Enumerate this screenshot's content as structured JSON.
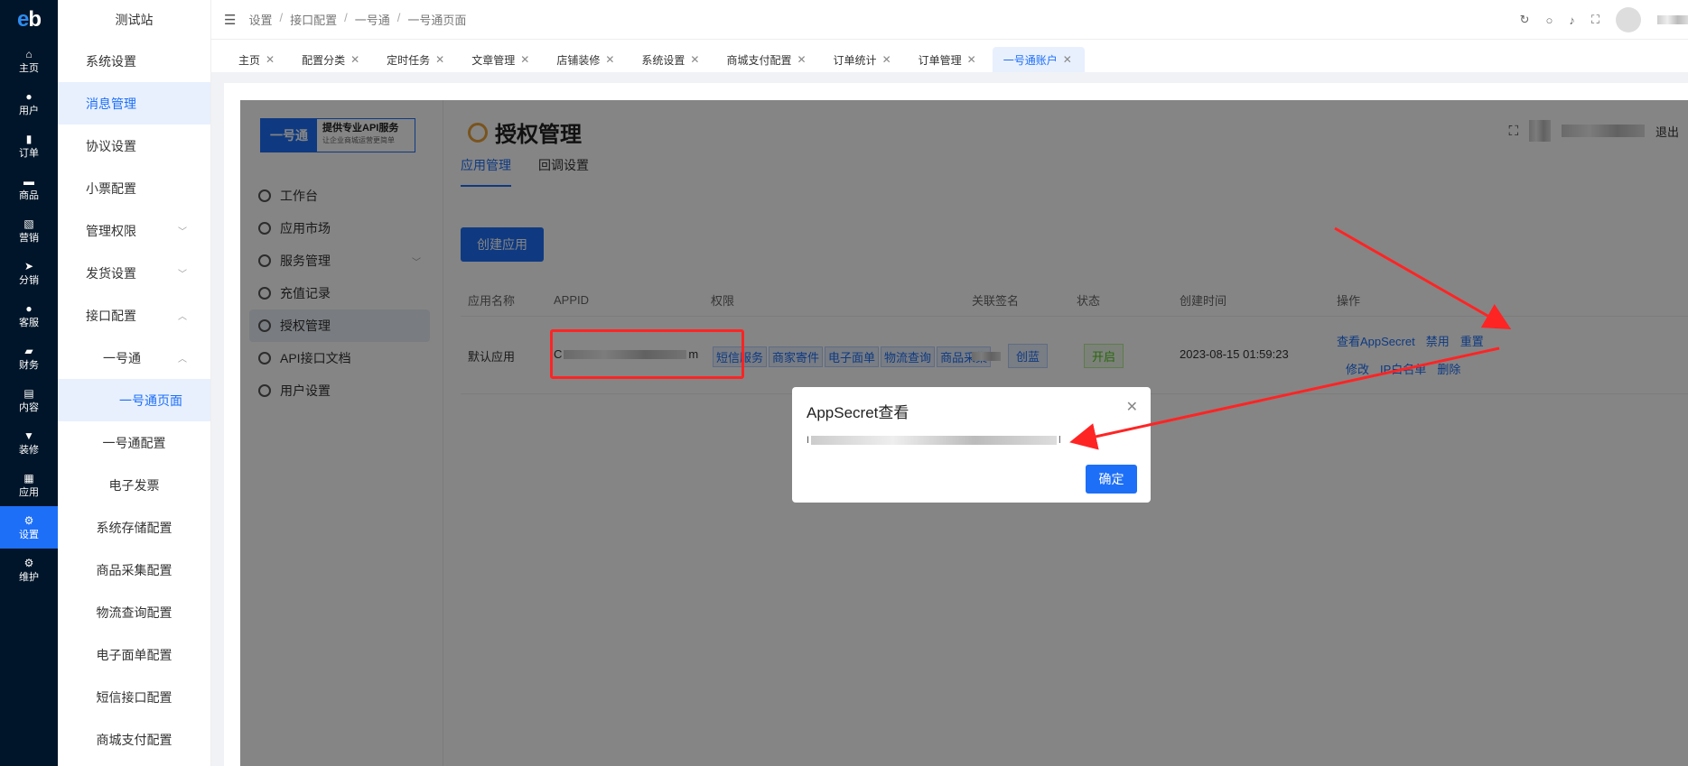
{
  "rail": {
    "logo_e": "e",
    "logo_b": "b",
    "items": [
      {
        "label": "主页",
        "icon": "⌂"
      },
      {
        "label": "用户",
        "icon": "●"
      },
      {
        "label": "订单",
        "icon": "▮"
      },
      {
        "label": "商品",
        "icon": "▬"
      },
      {
        "label": "营销",
        "icon": "▧"
      },
      {
        "label": "分销",
        "icon": "➤"
      },
      {
        "label": "客服",
        "icon": "●"
      },
      {
        "label": "财务",
        "icon": "▰"
      },
      {
        "label": "内容",
        "icon": "▤"
      },
      {
        "label": "装修",
        "icon": "▼"
      },
      {
        "label": "应用",
        "icon": "▦"
      },
      {
        "label": "设置",
        "icon": "⚙"
      },
      {
        "label": "维护",
        "icon": "⚙"
      }
    ]
  },
  "subnav": {
    "site": "测试站",
    "items": [
      "系统设置",
      "消息管理",
      "协议设置",
      "小票配置",
      "管理权限",
      "发货设置",
      "接口配置",
      "一号通",
      "一号通页面",
      "一号通配置",
      "电子发票",
      "系统存储配置",
      "商品采集配置",
      "物流查询配置",
      "电子面单配置",
      "短信接口配置",
      "商城支付配置"
    ]
  },
  "breadcrumb": [
    "设置",
    "接口配置",
    "一号通",
    "一号通页面"
  ],
  "tabs": [
    "主页",
    "配置分类",
    "定时任务",
    "文章管理",
    "店铺装修",
    "系统设置",
    "商城支付配置",
    "订单统计",
    "订单管理",
    "一号通账户"
  ],
  "inner": {
    "logo_a": "一号通",
    "logo_b1": "提供专业API服务",
    "logo_b2": "让企业商城运营更简单",
    "menu": [
      "工作台",
      "应用市场",
      "服务管理",
      "充值记录",
      "授权管理",
      "API接口文档",
      "用户设置"
    ],
    "page_title": "授权管理",
    "logout": "退出",
    "tabs": [
      "应用管理",
      "回调设置"
    ],
    "create_btn": "创建应用",
    "columns": [
      "应用名称",
      "APPID",
      "权限",
      "关联签名",
      "状态",
      "创建时间",
      "操作"
    ],
    "row": {
      "name": "默认应用",
      "appid_start": "C",
      "appid_end": "m",
      "perms": [
        "短信服务",
        "商家寄件",
        "电子面单",
        "物流查询",
        "商品采集"
      ],
      "sign_tag": "创蓝",
      "status": "开启",
      "created": "2023-08-15 01:59:23",
      "ops_row1": [
        "查看AppSecret",
        "禁用",
        "重置"
      ],
      "ops_row2": [
        "修改",
        "IP白名单",
        "删除"
      ]
    }
  },
  "modal": {
    "title": "AppSecret查看",
    "secret_start": "I",
    "secret_end": "l",
    "ok": "确定"
  },
  "colors": {
    "accent": "#1d6ff7",
    "rail_bg": "#001529",
    "annotation": "#ff2424"
  }
}
